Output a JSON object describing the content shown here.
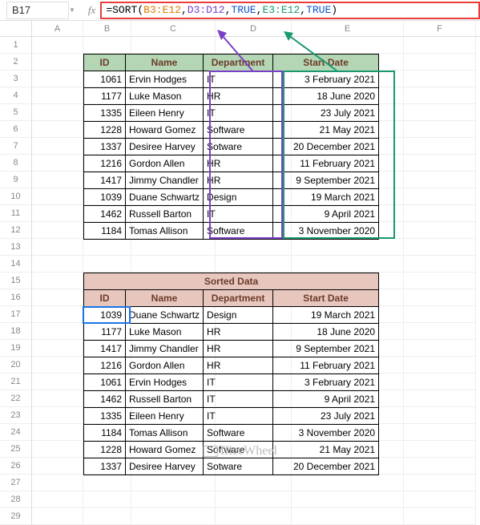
{
  "cellRef": "B17",
  "formula": {
    "fn": "SORT",
    "range1": "B3:E12",
    "range2": "D3:D12",
    "bool1": "TRUE",
    "range3": "E3:E12",
    "bool2": "TRUE"
  },
  "columns": [
    "A",
    "B",
    "C",
    "D",
    "E",
    "F"
  ],
  "rowCount": 29,
  "table1": {
    "headers": {
      "id": "ID",
      "name": "Name",
      "dept": "Department",
      "date": "Start Date"
    },
    "rows": [
      {
        "id": "1061",
        "name": "Ervin Hodges",
        "dept": "IT",
        "date": "3 February 2021"
      },
      {
        "id": "1177",
        "name": "Luke Mason",
        "dept": "HR",
        "date": "18 June 2020"
      },
      {
        "id": "1335",
        "name": "Eileen Henry",
        "dept": "IT",
        "date": "23 July 2021"
      },
      {
        "id": "1228",
        "name": "Howard Gomez",
        "dept": "Software",
        "date": "21 May 2021"
      },
      {
        "id": "1337",
        "name": "Desiree Harvey",
        "dept": "Sotware",
        "date": "20 December 2021"
      },
      {
        "id": "1216",
        "name": "Gordon Allen",
        "dept": "HR",
        "date": "11 February 2021"
      },
      {
        "id": "1417",
        "name": "Jimmy Chandler",
        "dept": "HR",
        "date": "9 September 2021"
      },
      {
        "id": "1039",
        "name": "Duane Schwartz",
        "dept": "Design",
        "date": "19 March 2021"
      },
      {
        "id": "1462",
        "name": "Russell Barton",
        "dept": "IT",
        "date": "9 April 2021"
      },
      {
        "id": "1184",
        "name": "Tomas Allison",
        "dept": "Software",
        "date": "3 November 2020"
      }
    ]
  },
  "table2": {
    "title": "Sorted Data",
    "headers": {
      "id": "ID",
      "name": "Name",
      "dept": "Department",
      "date": "Start Date"
    },
    "rows": [
      {
        "id": "1039",
        "name": "Duane Schwartz",
        "dept": "Design",
        "date": "19 March 2021"
      },
      {
        "id": "1177",
        "name": "Luke Mason",
        "dept": "HR",
        "date": "18 June 2020"
      },
      {
        "id": "1417",
        "name": "Jimmy Chandler",
        "dept": "HR",
        "date": "9 September 2021"
      },
      {
        "id": "1216",
        "name": "Gordon Allen",
        "dept": "HR",
        "date": "11 February 2021"
      },
      {
        "id": "1061",
        "name": "Ervin Hodges",
        "dept": "IT",
        "date": "3 February 2021"
      },
      {
        "id": "1462",
        "name": "Russell Barton",
        "dept": "IT",
        "date": "9 April 2021"
      },
      {
        "id": "1335",
        "name": "Eileen Henry",
        "dept": "IT",
        "date": "23 July 2021"
      },
      {
        "id": "1184",
        "name": "Tomas Allison",
        "dept": "Software",
        "date": "3 November 2020"
      },
      {
        "id": "1228",
        "name": "Howard Gomez",
        "dept": "Software",
        "date": "21 May 2021"
      },
      {
        "id": "1337",
        "name": "Desiree Harvey",
        "dept": "Sotware",
        "date": "20 December 2021"
      }
    ]
  },
  "watermark": "fficeWheel"
}
